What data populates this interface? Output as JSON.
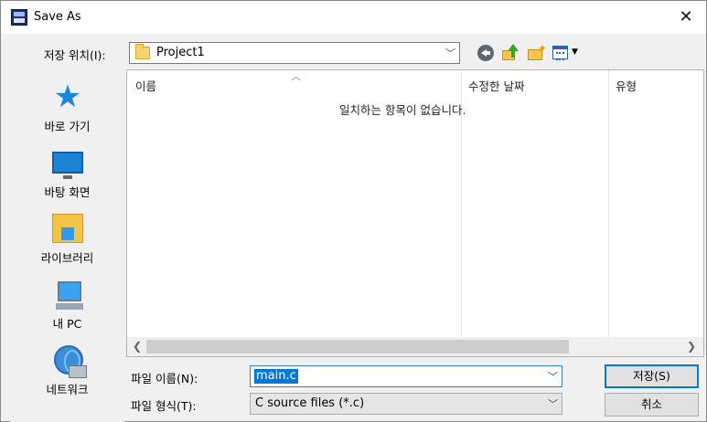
{
  "window": {
    "title": "Save As",
    "close_glyph": "✕"
  },
  "location": {
    "label": "저장 위치(I):",
    "value": "Project1"
  },
  "toolbar": {
    "icons": [
      "back-icon",
      "up-folder-icon",
      "new-folder-icon",
      "view-menu-icon"
    ]
  },
  "places": [
    {
      "label": "바로 가기",
      "icon": "quick-access-star-icon"
    },
    {
      "label": "바탕 화면",
      "icon": "desktop-icon"
    },
    {
      "label": "라이브러리",
      "icon": "libraries-icon"
    },
    {
      "label": "내 PC",
      "icon": "this-pc-icon"
    },
    {
      "label": "네트워크",
      "icon": "network-icon"
    }
  ],
  "filelist": {
    "columns": [
      "이름",
      "수정한 날짜",
      "유형"
    ],
    "empty_message": "일치하는 항목이 없습니다."
  },
  "filename": {
    "label": "파일 이름(N):",
    "value": "main.c"
  },
  "filetype": {
    "label": "파일 형식(T):",
    "value": "C source files (*.c)"
  },
  "buttons": {
    "save": "저장(S)",
    "cancel": "취소"
  },
  "colors": {
    "accent": "#0078d7",
    "folder": "#f6d470"
  }
}
